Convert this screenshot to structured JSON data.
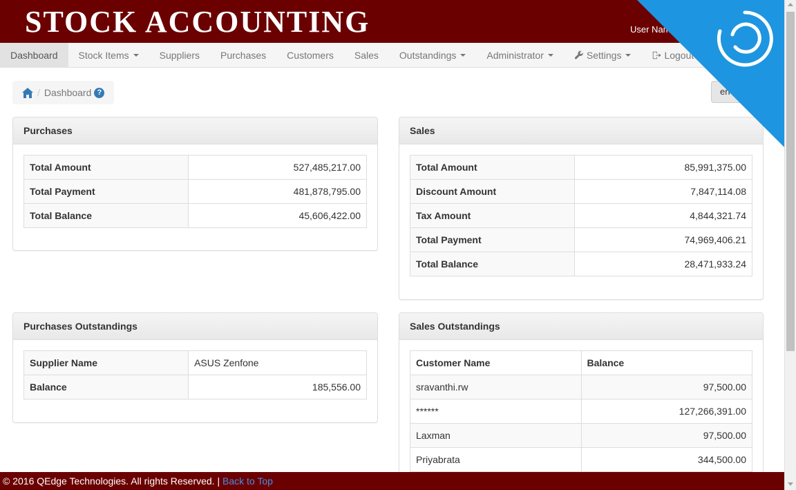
{
  "header": {
    "brand": "STOCK ACCOUNTING",
    "user_label": "User Nam"
  },
  "nav": {
    "items": [
      {
        "label": "Dashboard",
        "active": true,
        "dropdown": false
      },
      {
        "label": "Stock Items",
        "dropdown": true
      },
      {
        "label": "Suppliers",
        "dropdown": false
      },
      {
        "label": "Purchases",
        "dropdown": false
      },
      {
        "label": "Customers",
        "dropdown": false
      },
      {
        "label": "Sales",
        "dropdown": false
      },
      {
        "label": "Outstandings",
        "dropdown": true
      },
      {
        "label": "Administrator",
        "dropdown": true
      },
      {
        "label": "Settings",
        "dropdown": true,
        "icon": "wrench-icon"
      },
      {
        "label": "Logout",
        "dropdown": false,
        "icon": "logout-icon"
      }
    ]
  },
  "breadcrumb": {
    "home_icon": "home-icon",
    "current": "Dashboard",
    "help_icon": "question-circle-icon"
  },
  "language_button": "en",
  "purchases": {
    "title": "Purchases",
    "rows": [
      {
        "label": "Total Amount",
        "value": "527,485,217.00"
      },
      {
        "label": "Total Payment",
        "value": "481,878,795.00"
      },
      {
        "label": "Total Balance",
        "value": "45,606,422.00"
      }
    ]
  },
  "sales": {
    "title": "Sales",
    "rows": [
      {
        "label": "Total Amount",
        "value": "85,991,375.00"
      },
      {
        "label": "Discount Amount",
        "value": "7,847,114.08"
      },
      {
        "label": "Tax Amount",
        "value": "4,844,321.74"
      },
      {
        "label": "Total Payment",
        "value": "74,969,406.21"
      },
      {
        "label": "Total Balance",
        "value": "28,471,933.24"
      }
    ]
  },
  "purchases_outstandings": {
    "title": "Purchases Outstandings",
    "rows": [
      {
        "label": "Supplier Name",
        "value": "ASUS Zenfone"
      },
      {
        "label": "Balance",
        "value": "185,556.00"
      }
    ]
  },
  "sales_outstandings": {
    "title": "Sales Outstandings",
    "columns": [
      "Customer Name",
      "Balance"
    ],
    "rows": [
      {
        "name": "sravanthi.rw",
        "balance": "97,500.00"
      },
      {
        "name": "******",
        "balance": "127,266,391.00"
      },
      {
        "name": "Laxman",
        "balance": "97,500.00"
      },
      {
        "name": "Priyabrata",
        "balance": "344,500.00"
      }
    ]
  },
  "footer": {
    "copyright": "© 2016 QEdge Technologies. All rights Reserved. |",
    "back_to_top": "Back to Top"
  },
  "colors": {
    "header_bg": "#6b0000",
    "banner_blue": "#1e95e0",
    "link": "#4a8de0"
  }
}
